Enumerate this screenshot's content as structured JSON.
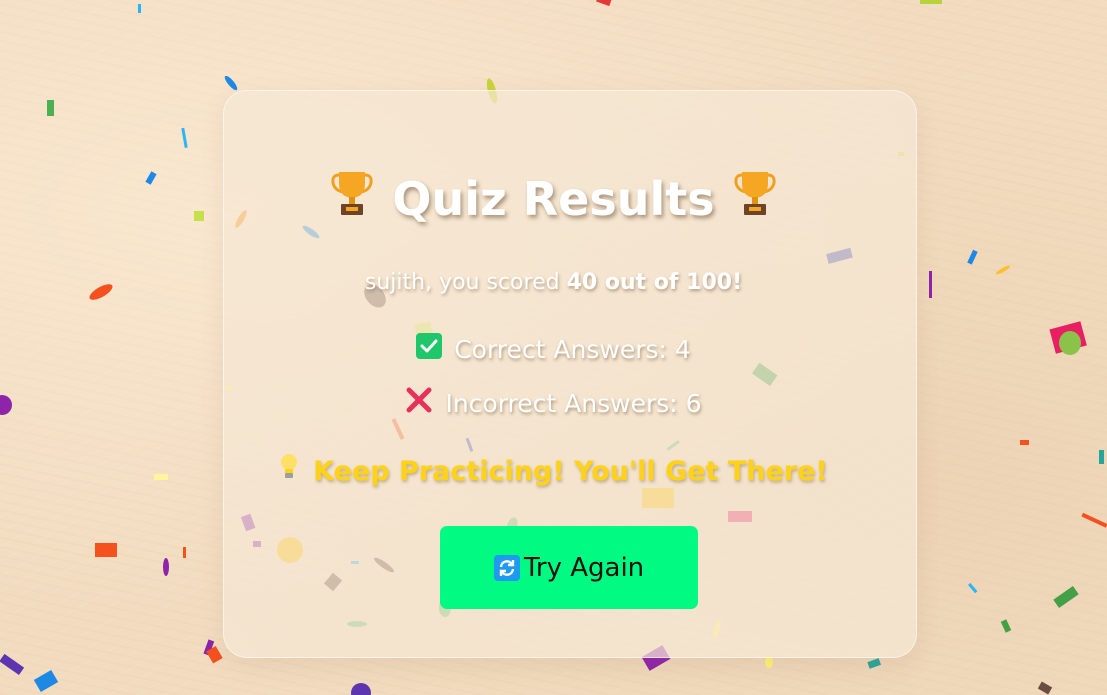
{
  "result": {
    "title": "Quiz Results",
    "score_prefix": "sujith, you scored ",
    "score_bold": "40 out of 100!",
    "correct_label": "Correct Answers: 4",
    "incorrect_label": "Incorrect Answers: 6",
    "message": "Keep Practicing! You'll Get There!",
    "try_again_label": "Try Again"
  },
  "colors": {
    "button": "#00fa82",
    "message": "#ffd21a",
    "check": "#1fc66a",
    "cross": "#e8305a"
  },
  "icons": [
    "trophy-icon",
    "check-icon",
    "cross-icon",
    "bulb-icon",
    "refresh-icon"
  ]
}
